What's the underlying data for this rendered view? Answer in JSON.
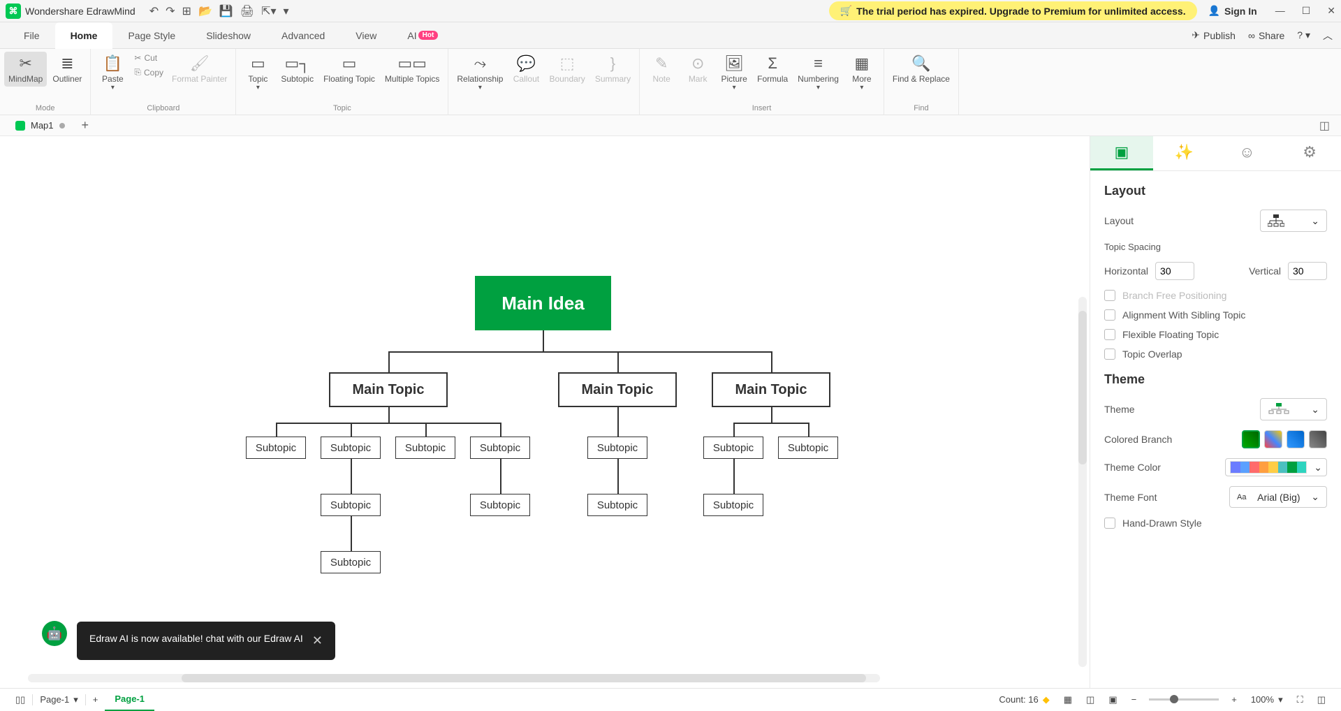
{
  "app": {
    "title": "Wondershare EdrawMind"
  },
  "trial": {
    "message": "The trial period has expired. Upgrade to Premium for unlimited access."
  },
  "signin": "Sign In",
  "menu": {
    "tabs": [
      "File",
      "Home",
      "Page Style",
      "Slideshow",
      "Advanced",
      "View",
      "AI"
    ],
    "publish": "Publish",
    "share": "Share"
  },
  "ribbon": {
    "mode": {
      "mindmap": "MindMap",
      "outliner": "Outliner",
      "group": "Mode"
    },
    "clipboard": {
      "paste": "Paste",
      "cut": "Cut",
      "copy": "Copy",
      "format_painter": "Format Painter",
      "group": "Clipboard"
    },
    "topic": {
      "topic": "Topic",
      "subtopic": "Subtopic",
      "floating": "Floating Topic",
      "multiple": "Multiple Topics",
      "group": "Topic"
    },
    "annotate": {
      "relationship": "Relationship",
      "callout": "Callout",
      "boundary": "Boundary",
      "summary": "Summary"
    },
    "insert": {
      "note": "Note",
      "mark": "Mark",
      "picture": "Picture",
      "formula": "Formula",
      "numbering": "Numbering",
      "more": "More",
      "group": "Insert"
    },
    "find": {
      "find_replace": "Find & Replace",
      "group": "Find"
    }
  },
  "doc": {
    "tab1": "Map1"
  },
  "mindmap": {
    "root": "Main Idea",
    "topics": [
      "Main Topic",
      "Main Topic",
      "Main Topic"
    ],
    "subtopic": "Subtopic"
  },
  "ai_popup": {
    "message": "Edraw AI is now available!  chat with our Edraw AI"
  },
  "panel": {
    "layout_title": "Layout",
    "layout_label": "Layout",
    "spacing_title": "Topic Spacing",
    "horizontal": "Horizontal",
    "vertical": "Vertical",
    "h_value": "30",
    "v_value": "30",
    "branch_free": "Branch Free Positioning",
    "alignment": "Alignment With Sibling Topic",
    "flexible": "Flexible Floating Topic",
    "overlap": "Topic Overlap",
    "theme_title": "Theme",
    "theme_label": "Theme",
    "colored_branch": "Colored Branch",
    "theme_color": "Theme Color",
    "theme_font": "Theme Font",
    "font_value": "Arial (Big)",
    "hand_drawn": "Hand-Drawn Style"
  },
  "status": {
    "page_select": "Page-1",
    "page_tab": "Page-1",
    "count": "Count: 16",
    "zoom": "100%"
  }
}
